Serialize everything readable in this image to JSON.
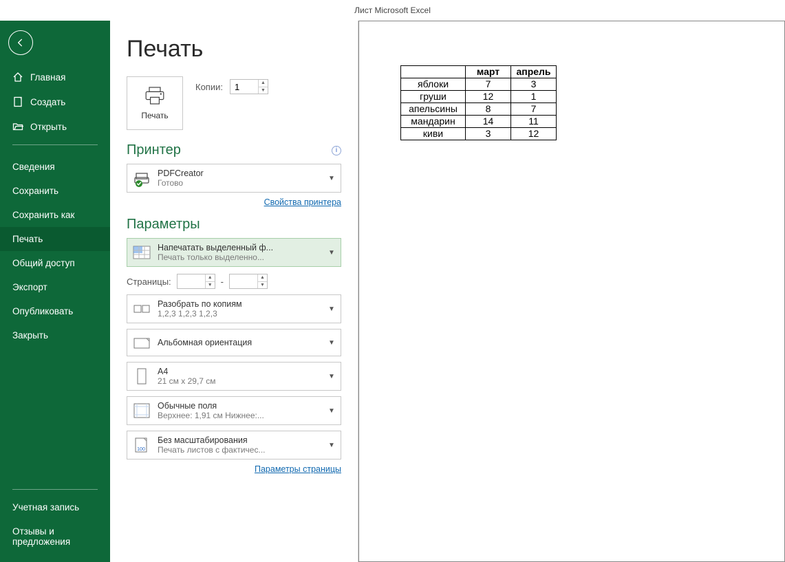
{
  "titlebar": {
    "document_title": "Лист Microsoft Excel"
  },
  "sidebar": {
    "items_top": [
      {
        "label": "Главная",
        "icon": "home"
      },
      {
        "label": "Создать",
        "icon": "new"
      },
      {
        "label": "Открыть",
        "icon": "open"
      }
    ],
    "items_mid": [
      {
        "label": "Сведения"
      },
      {
        "label": "Сохранить"
      },
      {
        "label": "Сохранить как"
      },
      {
        "label": "Печать",
        "active": true
      },
      {
        "label": "Общий доступ"
      },
      {
        "label": "Экспорт"
      },
      {
        "label": "Опубликовать"
      },
      {
        "label": "Закрыть"
      }
    ],
    "items_bottom": [
      {
        "label": "Учетная запись"
      },
      {
        "label": "Отзывы и предложения"
      }
    ]
  },
  "page": {
    "title": "Печать",
    "print_button_label": "Печать",
    "copies_label": "Копии:",
    "copies_value": "1"
  },
  "printer": {
    "section_title": "Принтер",
    "name": "PDFCreator",
    "status": "Готово",
    "properties_link": "Свойства принтера"
  },
  "settings": {
    "section_title": "Параметры",
    "print_area": {
      "t1": "Напечатать выделенный ф...",
      "t2": "Печать только выделенно..."
    },
    "pages_label": "Страницы:",
    "pages_from": "",
    "pages_to": "",
    "collate": {
      "t1": "Разобрать по копиям",
      "t2": "1,2,3    1,2,3    1,2,3"
    },
    "orientation": {
      "t1": "Альбомная ориентация"
    },
    "paper": {
      "t1": "A4",
      "t2": "21 см x 29,7 см"
    },
    "margins": {
      "t1": "Обычные поля",
      "t2": "Верхнее: 1,91 см Нижнее:..."
    },
    "scaling": {
      "t1": "Без масштабирования",
      "t2": "Печать листов с фактичес..."
    },
    "page_setup_link": "Параметры страницы"
  },
  "chart_data": {
    "type": "table",
    "columns": [
      "",
      "март",
      "апрель"
    ],
    "rows": [
      {
        "label": "яблоки",
        "values": [
          7,
          3
        ]
      },
      {
        "label": "груши",
        "values": [
          12,
          1
        ]
      },
      {
        "label": "апельсины",
        "values": [
          8,
          7
        ]
      },
      {
        "label": "мандарин",
        "values": [
          14,
          11
        ]
      },
      {
        "label": "киви",
        "values": [
          3,
          12
        ]
      }
    ]
  }
}
